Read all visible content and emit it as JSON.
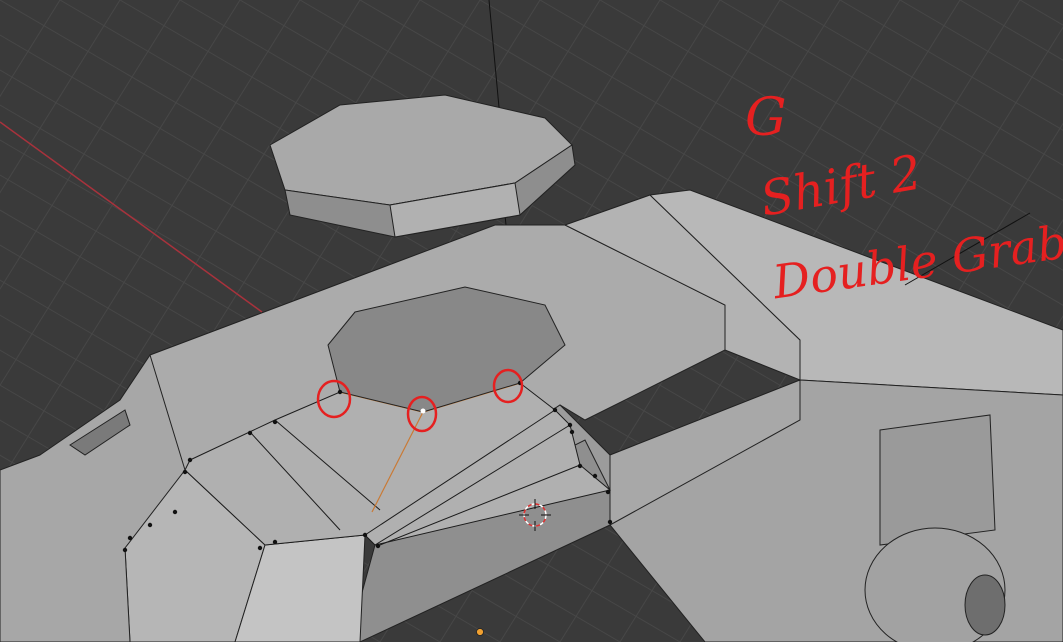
{
  "viewport": {
    "mode": "edit-mesh",
    "selection": "edge-loop"
  },
  "annotations": {
    "lines": [
      "G",
      "Shift 2",
      "Double Grab"
    ],
    "ink_color": "#e52020"
  },
  "colors": {
    "background": "#3a3a3a",
    "grid": "#474747",
    "x_axis": "#a8323c",
    "mesh_light": "#bfbfbf",
    "mesh_mid": "#a6a6a6",
    "mesh_dark": "#8c8c8c",
    "wire": "#1c1c1c",
    "selected_edge": "#e08a3a",
    "active_vertex": "#ffffff",
    "origin_dot": "#f0a030"
  }
}
